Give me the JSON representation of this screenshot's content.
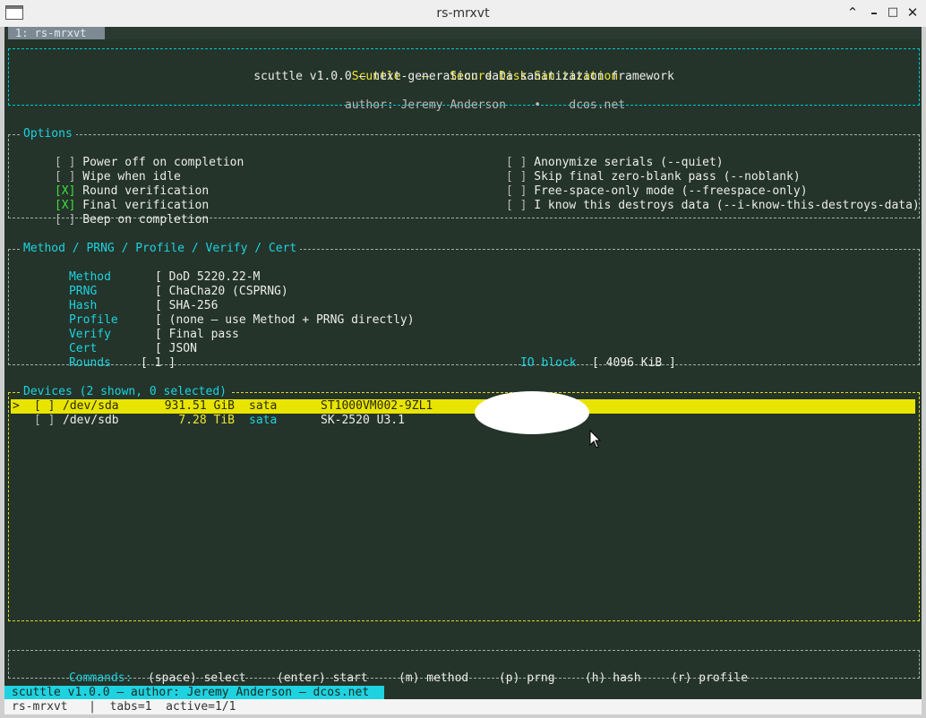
{
  "window": {
    "title": "rs-mrxvt"
  },
  "tabbar": {
    "tab_label": "1: rs-mrxvt"
  },
  "header": {
    "app_name": "Scuttle",
    "dash": "—",
    "tagline": "Secure Disk Sanitization",
    "subtitle": "scuttle v1.0.0 — next-generation data sanitization framework",
    "author": "author: Jeremy Anderson",
    "bullet": "•",
    "site": "dcos.net"
  },
  "options": {
    "title": "Options",
    "left": [
      {
        "mark": "[ ]",
        "label": "Power off on completion"
      },
      {
        "mark": "[ ]",
        "label": "Wipe when idle"
      },
      {
        "mark": "[X]",
        "label": "Round verification"
      },
      {
        "mark": "[X]",
        "label": "Final verification"
      },
      {
        "mark": "[ ]",
        "label": "Beep on completion"
      }
    ],
    "right": [
      {
        "mark": "[ ]",
        "label": "Anonymize serials (--quiet)"
      },
      {
        "mark": "[ ]",
        "label": "Skip final zero-blank pass (--noblank)"
      },
      {
        "mark": "[ ]",
        "label": "Free-space-only mode (--freespace-only)"
      },
      {
        "mark": "[ ]",
        "label": "I know this destroys data (--i-know-this-destroys-data)"
      }
    ]
  },
  "method_panel": {
    "title": "Method / PRNG / Profile / Verify / Cert",
    "rows": [
      {
        "key": "Method",
        "value": "[ DoD 5220.22-M"
      },
      {
        "key": "PRNG",
        "value": "[ ChaCha20 (CSPRNG)"
      },
      {
        "key": "Hash",
        "value": "[ SHA-256"
      },
      {
        "key": "Profile",
        "value": "[ (none — use Method + PRNG directly)"
      },
      {
        "key": "Verify",
        "value": "[ Final pass"
      },
      {
        "key": "Cert",
        "value": "[ JSON"
      }
    ],
    "rounds_key": "Rounds",
    "rounds_value": "[ 1 ]",
    "ioblock_key": "IO block",
    "ioblock_value": "[ 4096 KiB ]"
  },
  "devices": {
    "title": "Devices (2 shown, 0 selected)",
    "rows": [
      {
        "pointer": ">",
        "mark": "[ ]",
        "path": "/dev/sda",
        "size": "931.51 GiB",
        "bus": "sata",
        "model": "ST1000VM002-9ZL1"
      },
      {
        "pointer": "",
        "mark": "[ ]",
        "path": "/dev/sdb",
        "size": "7.28 TiB",
        "bus": "sata",
        "model": "SK-2520 U3.1"
      }
    ]
  },
  "commands": {
    "label": "Commands:",
    "items": [
      "(space) select",
      "(enter) start",
      "(m) method",
      "(p) prng",
      "(h) hash",
      "(r) profile"
    ]
  },
  "statusbar": {
    "text": "scuttle v1.0.0 — author: Jeremy Anderson — dcos.net"
  },
  "bottombar": {
    "text": "rs-mrxvt   |  tabs=1  active=1/1"
  },
  "colors": {
    "background": "#24342a",
    "accent_cyan": "#1ed2e0",
    "accent_yellow": "#f0e630",
    "check_green": "#3ee03e",
    "selection_bar": "#e8e400"
  }
}
